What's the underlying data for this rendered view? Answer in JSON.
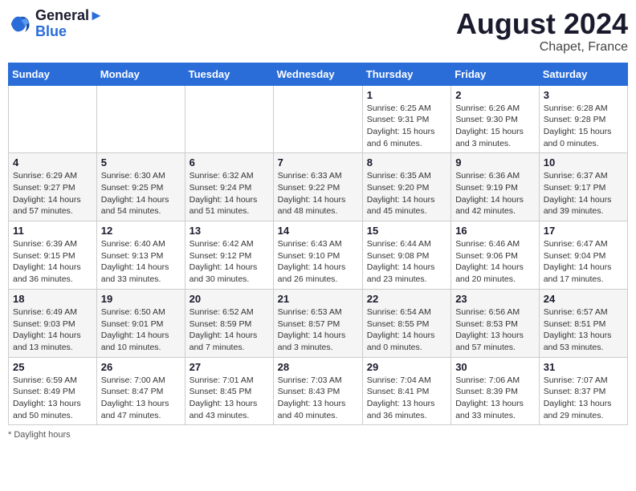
{
  "header": {
    "logo_line1": "General",
    "logo_line2": "Blue",
    "month_year": "August 2024",
    "location": "Chapet, France"
  },
  "weekdays": [
    "Sunday",
    "Monday",
    "Tuesday",
    "Wednesday",
    "Thursday",
    "Friday",
    "Saturday"
  ],
  "weeks": [
    [
      {
        "day": "",
        "info": ""
      },
      {
        "day": "",
        "info": ""
      },
      {
        "day": "",
        "info": ""
      },
      {
        "day": "",
        "info": ""
      },
      {
        "day": "1",
        "info": "Sunrise: 6:25 AM\nSunset: 9:31 PM\nDaylight: 15 hours\nand 6 minutes."
      },
      {
        "day": "2",
        "info": "Sunrise: 6:26 AM\nSunset: 9:30 PM\nDaylight: 15 hours\nand 3 minutes."
      },
      {
        "day": "3",
        "info": "Sunrise: 6:28 AM\nSunset: 9:28 PM\nDaylight: 15 hours\nand 0 minutes."
      }
    ],
    [
      {
        "day": "4",
        "info": "Sunrise: 6:29 AM\nSunset: 9:27 PM\nDaylight: 14 hours\nand 57 minutes."
      },
      {
        "day": "5",
        "info": "Sunrise: 6:30 AM\nSunset: 9:25 PM\nDaylight: 14 hours\nand 54 minutes."
      },
      {
        "day": "6",
        "info": "Sunrise: 6:32 AM\nSunset: 9:24 PM\nDaylight: 14 hours\nand 51 minutes."
      },
      {
        "day": "7",
        "info": "Sunrise: 6:33 AM\nSunset: 9:22 PM\nDaylight: 14 hours\nand 48 minutes."
      },
      {
        "day": "8",
        "info": "Sunrise: 6:35 AM\nSunset: 9:20 PM\nDaylight: 14 hours\nand 45 minutes."
      },
      {
        "day": "9",
        "info": "Sunrise: 6:36 AM\nSunset: 9:19 PM\nDaylight: 14 hours\nand 42 minutes."
      },
      {
        "day": "10",
        "info": "Sunrise: 6:37 AM\nSunset: 9:17 PM\nDaylight: 14 hours\nand 39 minutes."
      }
    ],
    [
      {
        "day": "11",
        "info": "Sunrise: 6:39 AM\nSunset: 9:15 PM\nDaylight: 14 hours\nand 36 minutes."
      },
      {
        "day": "12",
        "info": "Sunrise: 6:40 AM\nSunset: 9:13 PM\nDaylight: 14 hours\nand 33 minutes."
      },
      {
        "day": "13",
        "info": "Sunrise: 6:42 AM\nSunset: 9:12 PM\nDaylight: 14 hours\nand 30 minutes."
      },
      {
        "day": "14",
        "info": "Sunrise: 6:43 AM\nSunset: 9:10 PM\nDaylight: 14 hours\nand 26 minutes."
      },
      {
        "day": "15",
        "info": "Sunrise: 6:44 AM\nSunset: 9:08 PM\nDaylight: 14 hours\nand 23 minutes."
      },
      {
        "day": "16",
        "info": "Sunrise: 6:46 AM\nSunset: 9:06 PM\nDaylight: 14 hours\nand 20 minutes."
      },
      {
        "day": "17",
        "info": "Sunrise: 6:47 AM\nSunset: 9:04 PM\nDaylight: 14 hours\nand 17 minutes."
      }
    ],
    [
      {
        "day": "18",
        "info": "Sunrise: 6:49 AM\nSunset: 9:03 PM\nDaylight: 14 hours\nand 13 minutes."
      },
      {
        "day": "19",
        "info": "Sunrise: 6:50 AM\nSunset: 9:01 PM\nDaylight: 14 hours\nand 10 minutes."
      },
      {
        "day": "20",
        "info": "Sunrise: 6:52 AM\nSunset: 8:59 PM\nDaylight: 14 hours\nand 7 minutes."
      },
      {
        "day": "21",
        "info": "Sunrise: 6:53 AM\nSunset: 8:57 PM\nDaylight: 14 hours\nand 3 minutes."
      },
      {
        "day": "22",
        "info": "Sunrise: 6:54 AM\nSunset: 8:55 PM\nDaylight: 14 hours\nand 0 minutes."
      },
      {
        "day": "23",
        "info": "Sunrise: 6:56 AM\nSunset: 8:53 PM\nDaylight: 13 hours\nand 57 minutes."
      },
      {
        "day": "24",
        "info": "Sunrise: 6:57 AM\nSunset: 8:51 PM\nDaylight: 13 hours\nand 53 minutes."
      }
    ],
    [
      {
        "day": "25",
        "info": "Sunrise: 6:59 AM\nSunset: 8:49 PM\nDaylight: 13 hours\nand 50 minutes."
      },
      {
        "day": "26",
        "info": "Sunrise: 7:00 AM\nSunset: 8:47 PM\nDaylight: 13 hours\nand 47 minutes."
      },
      {
        "day": "27",
        "info": "Sunrise: 7:01 AM\nSunset: 8:45 PM\nDaylight: 13 hours\nand 43 minutes."
      },
      {
        "day": "28",
        "info": "Sunrise: 7:03 AM\nSunset: 8:43 PM\nDaylight: 13 hours\nand 40 minutes."
      },
      {
        "day": "29",
        "info": "Sunrise: 7:04 AM\nSunset: 8:41 PM\nDaylight: 13 hours\nand 36 minutes."
      },
      {
        "day": "30",
        "info": "Sunrise: 7:06 AM\nSunset: 8:39 PM\nDaylight: 13 hours\nand 33 minutes."
      },
      {
        "day": "31",
        "info": "Sunrise: 7:07 AM\nSunset: 8:37 PM\nDaylight: 13 hours\nand 29 minutes."
      }
    ]
  ],
  "footer": {
    "note": "Daylight hours"
  }
}
